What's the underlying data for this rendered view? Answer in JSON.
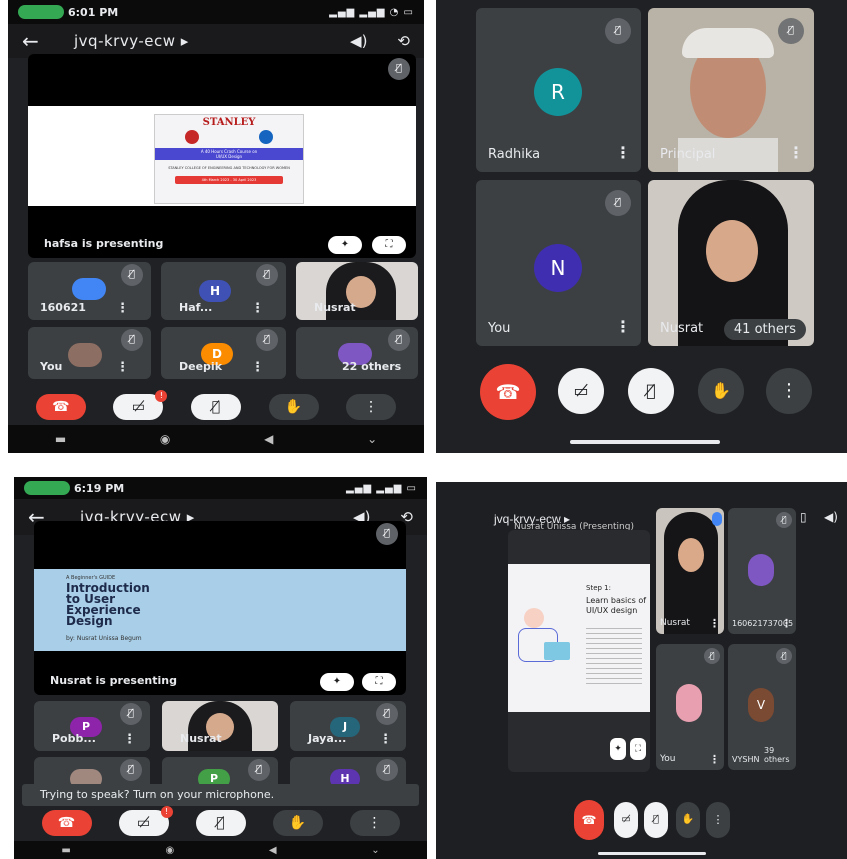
{
  "meeting_code": "jvq-krvy-ecw",
  "panel1": {
    "time": "6:01 PM",
    "presenter_label": "hafsa is presenting",
    "slide": {
      "brand": "STANLEY",
      "line1": "A 40 Hours Crash Course on",
      "line2": "UI/UX Design",
      "line3": "STANLEY COLLEGE OF ENGINEERING AND TECHNOLOGY FOR WOMEN",
      "dates": "4th March 2023 - 30 April 2023"
    },
    "tiles": [
      {
        "name": "160621",
        "initial": "",
        "color": "#4285f4"
      },
      {
        "name": "Haf...",
        "initial": "H",
        "color": "#3f51b5"
      },
      {
        "name": "Nusrat",
        "initial": "",
        "color": ""
      },
      {
        "name": "You",
        "initial": "",
        "color": ""
      },
      {
        "name": "Deepik",
        "initial": "D",
        "color": "#fb8c00"
      },
      {
        "name": "22 others",
        "initial": "",
        "color": "#7e57c2"
      }
    ],
    "badge_count": "!"
  },
  "panel2": {
    "tiles": [
      {
        "name": "Radhika",
        "initial": "R",
        "color": "#12939a"
      },
      {
        "name": "Principal",
        "initial": "",
        "color": ""
      },
      {
        "name": "You",
        "initial": "N",
        "color": "#3f2fb0"
      },
      {
        "name": "Nusrat",
        "initial": "",
        "color": ""
      }
    ],
    "others": "41 others"
  },
  "panel3": {
    "time": "6:19 PM",
    "presenter_label": "Nusrat is presenting",
    "slide": {
      "kicker": "A Beginner's GUIDE",
      "title_l1": "Introduction",
      "title_l2": "to User",
      "title_l3": "Experience",
      "title_l4": "Design",
      "byline": "by: Nusrat Unissa Begum"
    },
    "tiles": [
      {
        "name": "Pobb...",
        "initial": "P",
        "color": "#8e24aa"
      },
      {
        "name": "Nusrat",
        "initial": "",
        "color": ""
      },
      {
        "name": "Jaya...",
        "initial": "J",
        "color": "#26667a"
      },
      {
        "name": "",
        "initial": "",
        "color": ""
      },
      {
        "name": "",
        "initial": "P",
        "color": "#43a047"
      },
      {
        "name": "",
        "initial": "H",
        "color": "#5e35b1"
      }
    ],
    "toast": "Trying to speak? Turn on your microphone."
  },
  "panel4": {
    "title": "jvq-krvy-ecw",
    "presenting": "Nusrat Unissa (Presenting)",
    "slide": {
      "step": "Step 1:",
      "heading_l1": "Learn basics of",
      "heading_l2": "UI/UX design"
    },
    "tiles": [
      {
        "name": "Nusrat"
      },
      {
        "name": "160621737005"
      },
      {
        "name": "You"
      },
      {
        "name": "VYSHN",
        "initial": "V",
        "color": "#7b4a32"
      }
    ],
    "others": "39 others"
  }
}
